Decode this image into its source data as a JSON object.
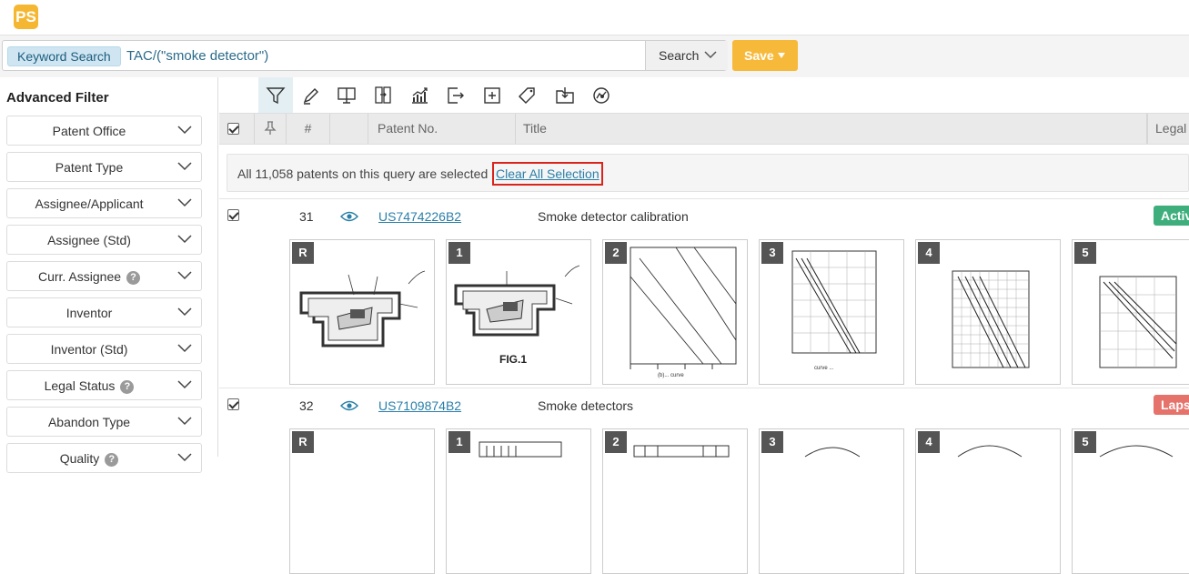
{
  "app": {
    "logo_text": "PS"
  },
  "search": {
    "tag_label": "Keyword Search",
    "query": "TAC/(\"smoke detector\")",
    "button_label": "Search",
    "save_label": "Save"
  },
  "sidebar": {
    "title": "Advanced Filter",
    "filters": [
      {
        "label": "Patent Office",
        "help": false
      },
      {
        "label": "Patent Type",
        "help": false
      },
      {
        "label": "Assignee/Applicant",
        "help": false
      },
      {
        "label": "Assignee (Std)",
        "help": false
      },
      {
        "label": "Curr. Assignee",
        "help": true
      },
      {
        "label": "Inventor",
        "help": false
      },
      {
        "label": "Inventor (Std)",
        "help": false
      },
      {
        "label": "Legal Status",
        "help": true
      },
      {
        "label": "Abandon Type",
        "help": false
      },
      {
        "label": "Quality",
        "help": true
      }
    ]
  },
  "toolbar": {
    "icons": [
      "filter-icon",
      "highlight-icon",
      "monitor-icon",
      "compare-icon",
      "chart-icon",
      "export-icon",
      "add-icon",
      "tag-icon",
      "save-folder-icon",
      "analysis-icon"
    ]
  },
  "table": {
    "headers": {
      "num": "#",
      "patent_no": "Patent No.",
      "title": "Title",
      "legal": "Legal"
    }
  },
  "selection_notice": {
    "text": "All 11,058 patents on this query are selected",
    "clear_label": "Clear All Selection"
  },
  "rows": [
    {
      "num": "31",
      "patent_no": "US7474226B2",
      "title": "Smoke detector calibration",
      "status": "Activ",
      "status_color": "#3fae7d",
      "thumbs": [
        "R",
        "1",
        "2",
        "3",
        "4",
        "5"
      ],
      "fig_caption": "FIG.1"
    },
    {
      "num": "32",
      "patent_no": "US7109874B2",
      "title": "Smoke detectors",
      "status": "Lapse",
      "status_color": "#e5736b",
      "thumbs": [
        "R",
        "1",
        "2",
        "3",
        "4",
        "5"
      ]
    }
  ]
}
